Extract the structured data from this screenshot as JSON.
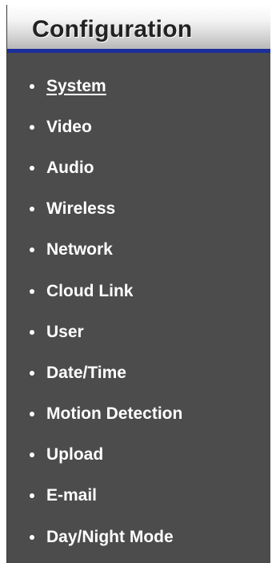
{
  "header": {
    "title": "Configuration"
  },
  "menu": {
    "active": "System",
    "items": [
      {
        "label": "System"
      },
      {
        "label": "Video"
      },
      {
        "label": "Audio"
      },
      {
        "label": "Wireless"
      },
      {
        "label": "Network"
      },
      {
        "label": "Cloud Link"
      },
      {
        "label": "User"
      },
      {
        "label": "Date/Time"
      },
      {
        "label": "Motion Detection"
      },
      {
        "label": "Upload"
      },
      {
        "label": "E-mail"
      },
      {
        "label": "Day/Night Mode"
      }
    ]
  },
  "colors": {
    "panel_background": "#4c4c4c",
    "header_underline": "#1c2f9a",
    "menu_text": "#ffffff",
    "header_text": "#222222"
  }
}
